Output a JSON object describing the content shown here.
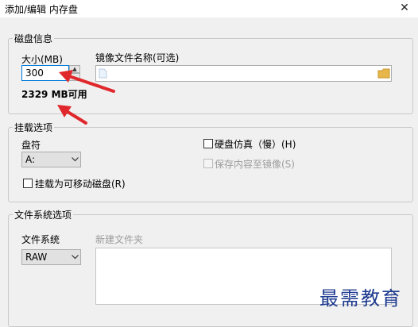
{
  "window": {
    "title": "添加/编辑 内存盘",
    "close_glyph": "✕"
  },
  "disk_info": {
    "group_title": "磁盘信息",
    "size_label": "大小(MB)",
    "size_value": "300",
    "image_name_label": "镜像文件名称(可选)",
    "image_name_value": "",
    "free_text": "2329 MB可用"
  },
  "mount_options": {
    "group_title": "挂载选项",
    "drive_letter_label": "盘符",
    "drive_letter_value": "A:",
    "removable_label": "挂载为可移动磁盘(R)",
    "removable_checked": false,
    "hd_emulation_label": "硬盘仿真（慢）(H)",
    "hd_emulation_checked": false,
    "save_to_image_label": "保存内容至镜像(S)",
    "save_to_image_checked": false
  },
  "fs_options": {
    "group_title": "文件系统选项",
    "fs_label": "文件系统",
    "fs_value": "RAW",
    "new_folder_label": "新建文件夹"
  },
  "watermark": {
    "text": "最需教育"
  },
  "colors": {
    "arrow": "#e0282c",
    "folder": "#e8b74c",
    "accent_border": "#0078d7"
  },
  "icons": [
    "close-icon",
    "spin-up-icon",
    "file-icon",
    "folder-icon",
    "dropdown-arrow-icon",
    "arrow-annotation"
  ]
}
